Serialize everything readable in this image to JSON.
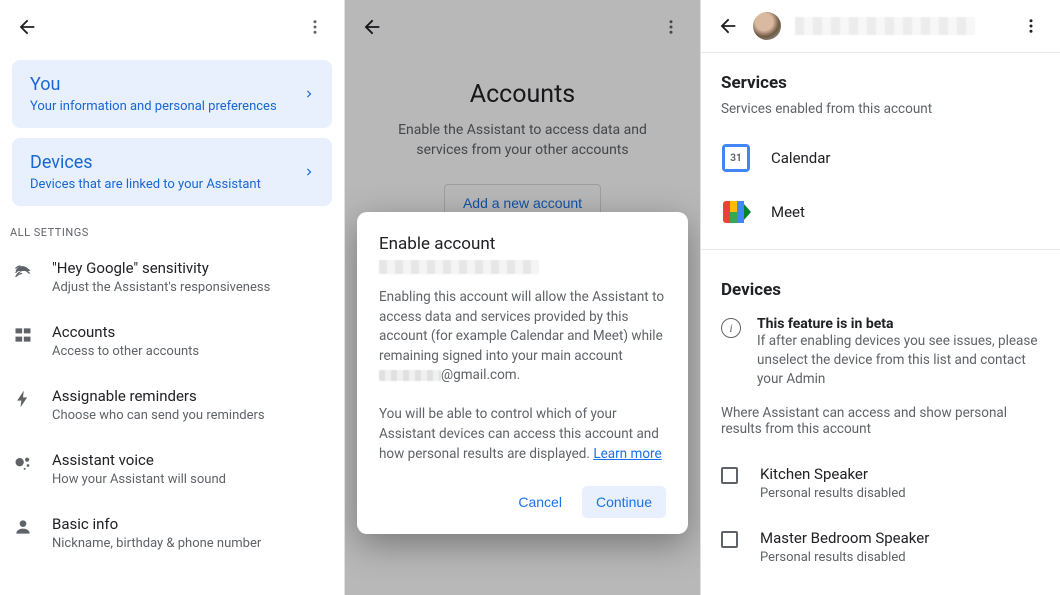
{
  "panel1": {
    "cards": [
      {
        "title": "You",
        "sub": "Your information and personal preferences"
      },
      {
        "title": "Devices",
        "sub": "Devices that are linked to your Assistant"
      }
    ],
    "section_label": "ALL SETTINGS",
    "settings": [
      {
        "title": "\"Hey Google\" sensitivity",
        "sub": "Adjust the Assistant's responsiveness"
      },
      {
        "title": "Accounts",
        "sub": "Access to other accounts"
      },
      {
        "title": "Assignable reminders",
        "sub": "Choose who can send you reminders"
      },
      {
        "title": "Assistant voice",
        "sub": "How your Assistant will sound"
      },
      {
        "title": "Basic info",
        "sub": "Nickname, birthday & phone number"
      }
    ]
  },
  "panel2": {
    "title": "Accounts",
    "desc": "Enable the Assistant to access data and services from your other accounts",
    "add_button": "Add a new account",
    "dialog": {
      "title": "Enable account",
      "body1": "Enabling this account will allow the Assistant to access data and services provided by this account (for example Calendar and Meet) while remaining signed into your main account ",
      "email_suffix": "@gmail.com.",
      "body2": "You will be able to control which of your Assistant devices can access this account and how personal results are displayed. ",
      "learn": "Learn more",
      "cancel": "Cancel",
      "continue": "Continue"
    }
  },
  "panel3": {
    "services_title": "Services",
    "services_sub": "Services enabled from this account",
    "services": [
      {
        "label": "Calendar"
      },
      {
        "label": "Meet"
      }
    ],
    "devices_title": "Devices",
    "beta_title": "This feature is in beta",
    "beta_body": "If after enabling devices you see issues, please unselect the device from this list and contact your Admin",
    "devices_desc": "Where Assistant can access and show personal results from this account",
    "devices": [
      {
        "title": "Kitchen Speaker",
        "sub": "Personal results disabled"
      },
      {
        "title": "Master Bedroom Speaker",
        "sub": "Personal results disabled"
      }
    ]
  }
}
